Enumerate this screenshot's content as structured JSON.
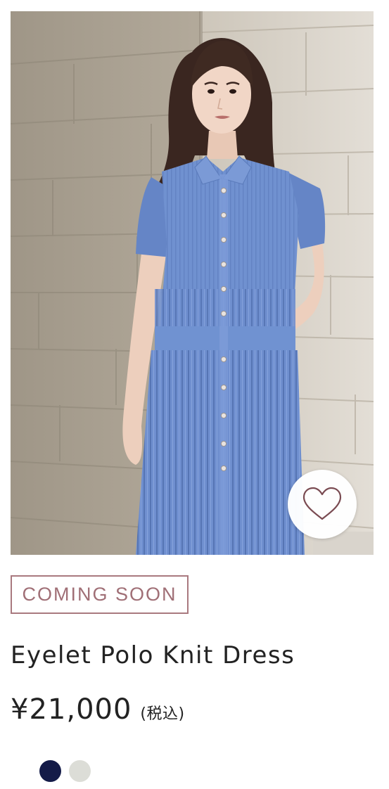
{
  "product": {
    "image": {
      "description_icon": "product-photo",
      "dress_color": "#6e8fcd"
    },
    "favorite": {
      "icon": "heart-outline-icon",
      "stroke_color": "#7a4b52"
    },
    "badge": {
      "label": "COMING SOON",
      "color": "#a06f76"
    },
    "title": "Eyelet Polo Knit Dress",
    "price": {
      "amount": "¥21,000",
      "tax_note": "(税込)"
    },
    "colors": [
      {
        "name": "navy",
        "hex": "#141b48"
      },
      {
        "name": "light-gray",
        "hex": "#dcddd7"
      }
    ]
  }
}
